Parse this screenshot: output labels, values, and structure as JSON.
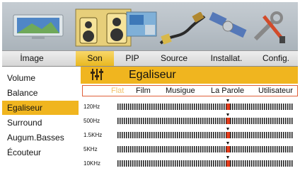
{
  "tabs": [
    {
      "label": "İmage",
      "active": false
    },
    {
      "label": "Son",
      "active": true
    },
    {
      "label": "PIP",
      "active": false
    },
    {
      "label": "Source",
      "active": false
    },
    {
      "label": "Installat.",
      "active": false
    },
    {
      "label": "Config.",
      "active": false
    }
  ],
  "menu": {
    "items": [
      {
        "label": "Volume",
        "selected": false
      },
      {
        "label": "Balance",
        "selected": false
      },
      {
        "label": "Egaliseur",
        "selected": true
      },
      {
        "label": "Surround",
        "selected": false
      },
      {
        "label": "Augum.Basses",
        "selected": false
      },
      {
        "label": "Écouteur",
        "selected": false
      }
    ]
  },
  "panel": {
    "title": "Egaliseur",
    "icon": "equalizer-icon",
    "presets": [
      {
        "label": "Flat",
        "active": true
      },
      {
        "label": "Film",
        "active": false
      },
      {
        "label": "Musigue",
        "active": false
      },
      {
        "label": "La Parole",
        "active": false
      },
      {
        "label": "Utilisateur",
        "active": false
      }
    ],
    "bands": [
      {
        "label": "120Hz",
        "level": 0.63
      },
      {
        "label": "500Hz",
        "level": 0.63
      },
      {
        "label": "1.5KHz",
        "level": 0.63
      },
      {
        "label": "5KHz",
        "level": 0.63
      },
      {
        "label": "10KHz",
        "level": 0.63
      }
    ]
  },
  "colors": {
    "accent": "#f0b51f",
    "knob": "#e23c1c",
    "preset_border": "#e0603a",
    "preset_active": "#f2c26a"
  },
  "icons": [
    "image-monitor-icon",
    "sound-speakers-icon",
    "pip-icon",
    "source-cable-icon",
    "installation-satellite-icon",
    "config-tools-icon"
  ]
}
